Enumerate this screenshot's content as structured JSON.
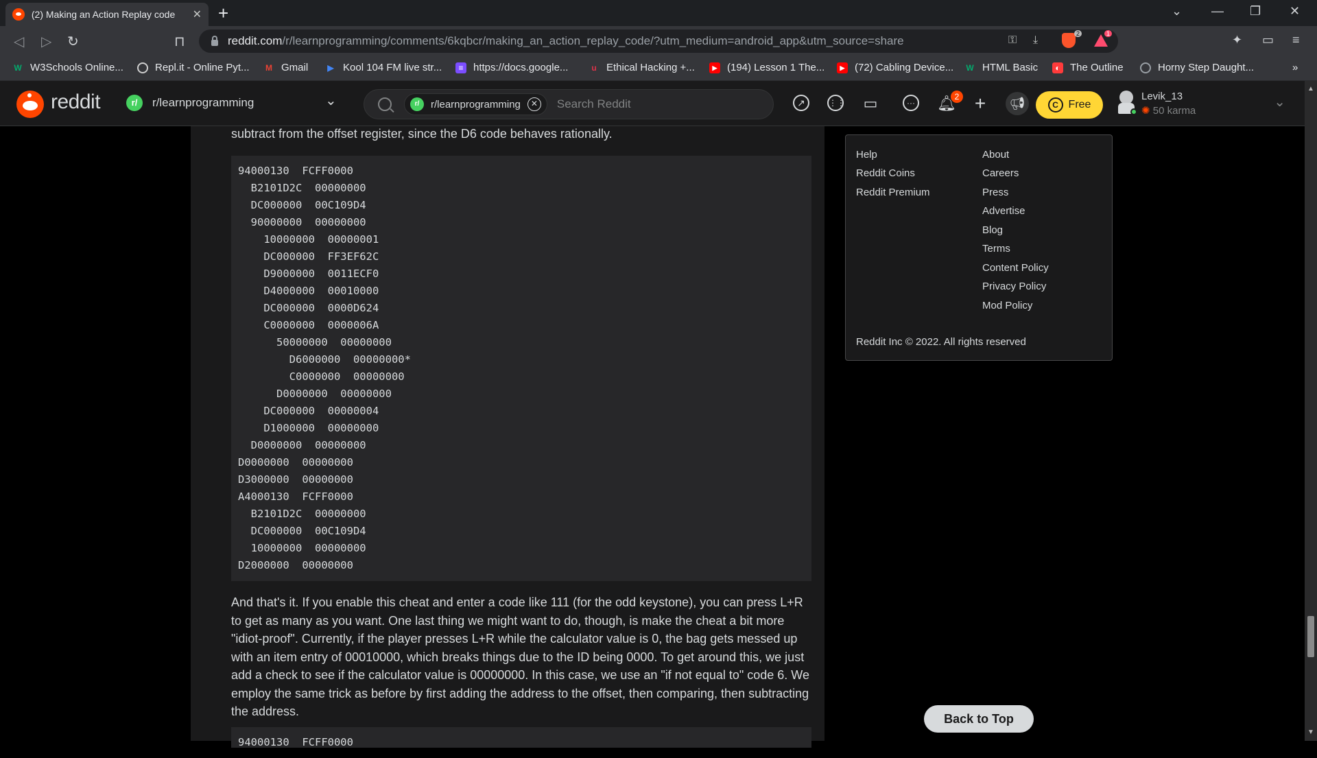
{
  "browser": {
    "tab_title": "(2) Making an Action Replay code",
    "url_host": "reddit.com",
    "url_path": "/r/learnprogramming/comments/6kqbcr/making_an_action_replay_code/?utm_medium=android_app&utm_source=share",
    "bookmarks": [
      {
        "label": "W3Schools Online...",
        "icon": "w3schools-icon",
        "color": "#04aa6d"
      },
      {
        "label": "Repl.it - Online Pyt...",
        "icon": "replit-icon",
        "color": "#cfcfcf"
      },
      {
        "label": "Gmail",
        "icon": "gmail-icon",
        "color": "#ea4335"
      },
      {
        "label": "Kool 104 FM live str...",
        "icon": "play-icon",
        "color": "#4285f4"
      },
      {
        "label": "https://docs.google...",
        "icon": "docs-icon",
        "color": "#7b4dff"
      },
      {
        "label": "Ethical Hacking +...",
        "icon": "udemy-icon",
        "color": "#e0334a"
      },
      {
        "label": "(194) Lesson 1 The...",
        "icon": "youtube-icon",
        "color": "#ff0000"
      },
      {
        "label": "(72) Cabling Device...",
        "icon": "youtube-icon",
        "color": "#ff0000"
      },
      {
        "label": "HTML Basic",
        "icon": "w3schools-icon",
        "color": "#04aa6d"
      },
      {
        "label": "The Outline",
        "icon": "outline-icon",
        "color": "#ff3b3b"
      },
      {
        "label": "Horny Step Daught...",
        "icon": "globe-icon",
        "color": "#9aa0a6"
      }
    ],
    "more_bookmarks": "»"
  },
  "reddit": {
    "wordmark": "reddit",
    "community": "r/learnprogramming",
    "search_chip": "r/learnprogramming",
    "search_placeholder": "Search Reddit",
    "notification_count": "2",
    "free_label": "Free",
    "username": "Levik_13",
    "karma": "50 karma",
    "colors": {
      "brand": "#ff4500",
      "coins": "#ffd635",
      "online": "#46d160"
    }
  },
  "post": {
    "para_top": "subtract from the offset register, since the D6 code behaves rationally.",
    "code_lines": [
      "94000130  FCFF0000",
      "  B2101D2C  00000000",
      "  DC000000  00C109D4",
      "  90000000  00000000",
      "    10000000  00000001",
      "    DC000000  FF3EF62C",
      "    D9000000  0011ECF0",
      "    D4000000  00010000",
      "    DC000000  0000D624",
      "    C0000000  0000006A",
      "      50000000  00000000",
      "        D6000000  00000000*",
      "        C0000000  00000000",
      "      D0000000  00000000",
      "    DC000000  00000004",
      "    D1000000  00000000",
      "  D0000000  00000000",
      "D0000000  00000000",
      "D3000000  00000000",
      "A4000130  FCFF0000",
      "  B2101D2C  00000000",
      "  DC000000  00C109D4",
      "  10000000  00000000",
      "D2000000  00000000"
    ],
    "para_bottom": "And that's it. If you enable this cheat and enter a code like 111 (for the odd keystone), you can press L+R to get as many as you want. One last thing we might want to do, though, is make the cheat a bit more \"idiot-proof\". Currently, if the player presses L+R while the calculator value is 0, the bag gets messed up with an item entry of 00010000, which breaks things due to the ID being 0000. To get around this, we just add a check to see if the calculator value is 00000000. In this case, we use an \"if not equal to\" code 6. We employ the same trick as before by first adding the address to the offset, then comparing, then subtracting the address.",
    "code2_first_line": "94000130  FCFF0000"
  },
  "footer": {
    "col1": [
      "Help",
      "Reddit Coins",
      "Reddit Premium"
    ],
    "col2": [
      "About",
      "Careers",
      "Press",
      "Advertise",
      "Blog",
      "Terms",
      "Content Policy",
      "Privacy Policy",
      "Mod Policy"
    ],
    "copyright": "Reddit Inc © 2022. All rights reserved",
    "back_to_top": "Back to Top"
  }
}
